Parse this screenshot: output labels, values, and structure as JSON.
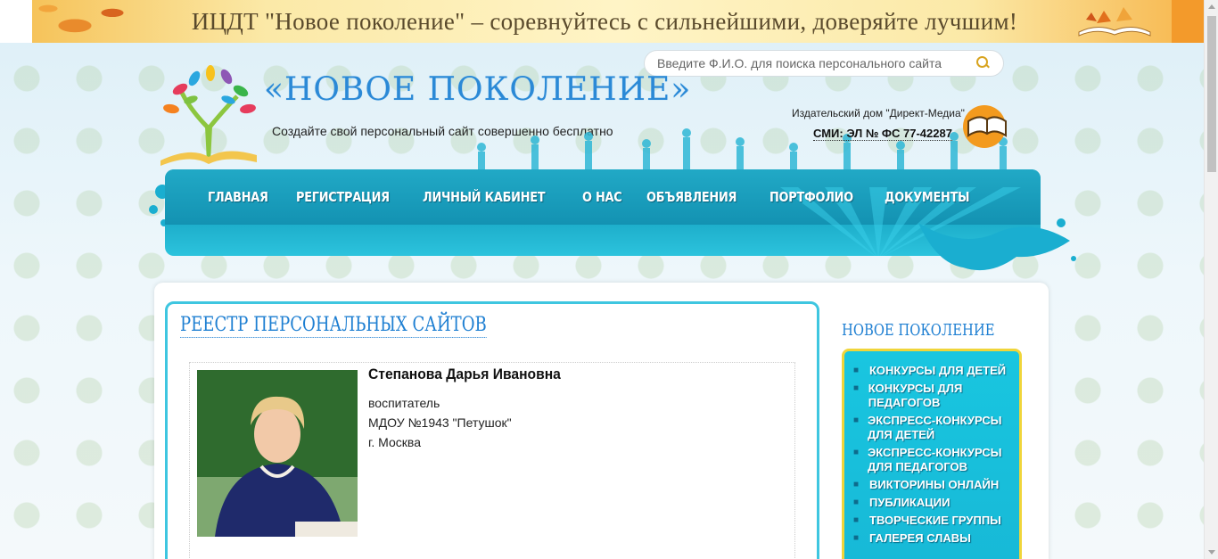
{
  "banner": {
    "text": "ИЦДТ \"Новое поколение\" – соревнуйтесь с сильнейшими, доверяйте лучшим!"
  },
  "header": {
    "search_placeholder": "Введите Ф.И.О. для поиска персонального сайта",
    "site_title": "«НОВОЕ ПОКОЛЕНИЕ»",
    "slogan": "Создайте свой персональный сайт совершенно бесплатно",
    "publisher": "Издательский дом \"Директ-Медиа\"",
    "smi": "СМИ: ЭЛ № ФС 77-42287"
  },
  "nav": {
    "items": [
      {
        "label": "Главная"
      },
      {
        "label": "Регистрация"
      },
      {
        "label": "Личный кабинет"
      },
      {
        "label": "О нас"
      },
      {
        "label": "Объявления"
      },
      {
        "label": "Портфолио"
      },
      {
        "label": "Документы"
      }
    ]
  },
  "main": {
    "title": "РЕЕСТР ПЕРСОНАЛЬНЫХ САЙТОВ",
    "profile": {
      "name": "Степанова Дарья Ивановна",
      "position": "воспитатель",
      "organization": "МДОУ №1943 \"Петушок\"",
      "city": "г. Москва"
    }
  },
  "sidebar": {
    "title": "НОВОЕ ПОКОЛЕНИЕ",
    "items": [
      {
        "label": "Конкурсы для детей"
      },
      {
        "label": "Конкурсы для педагогов"
      },
      {
        "label": "Экспресс-конкурсы для детей"
      },
      {
        "label": "Экспресс-конкурсы для педагогов"
      },
      {
        "label": "Викторины онлайн"
      },
      {
        "label": "Публикации"
      },
      {
        "label": "Творческие группы"
      },
      {
        "label": "Галерея славы"
      }
    ]
  },
  "colors": {
    "accent_blue": "#1e7fd2",
    "nav_teal": "#1ab6d2",
    "sidebar_border": "#f0d53a"
  }
}
